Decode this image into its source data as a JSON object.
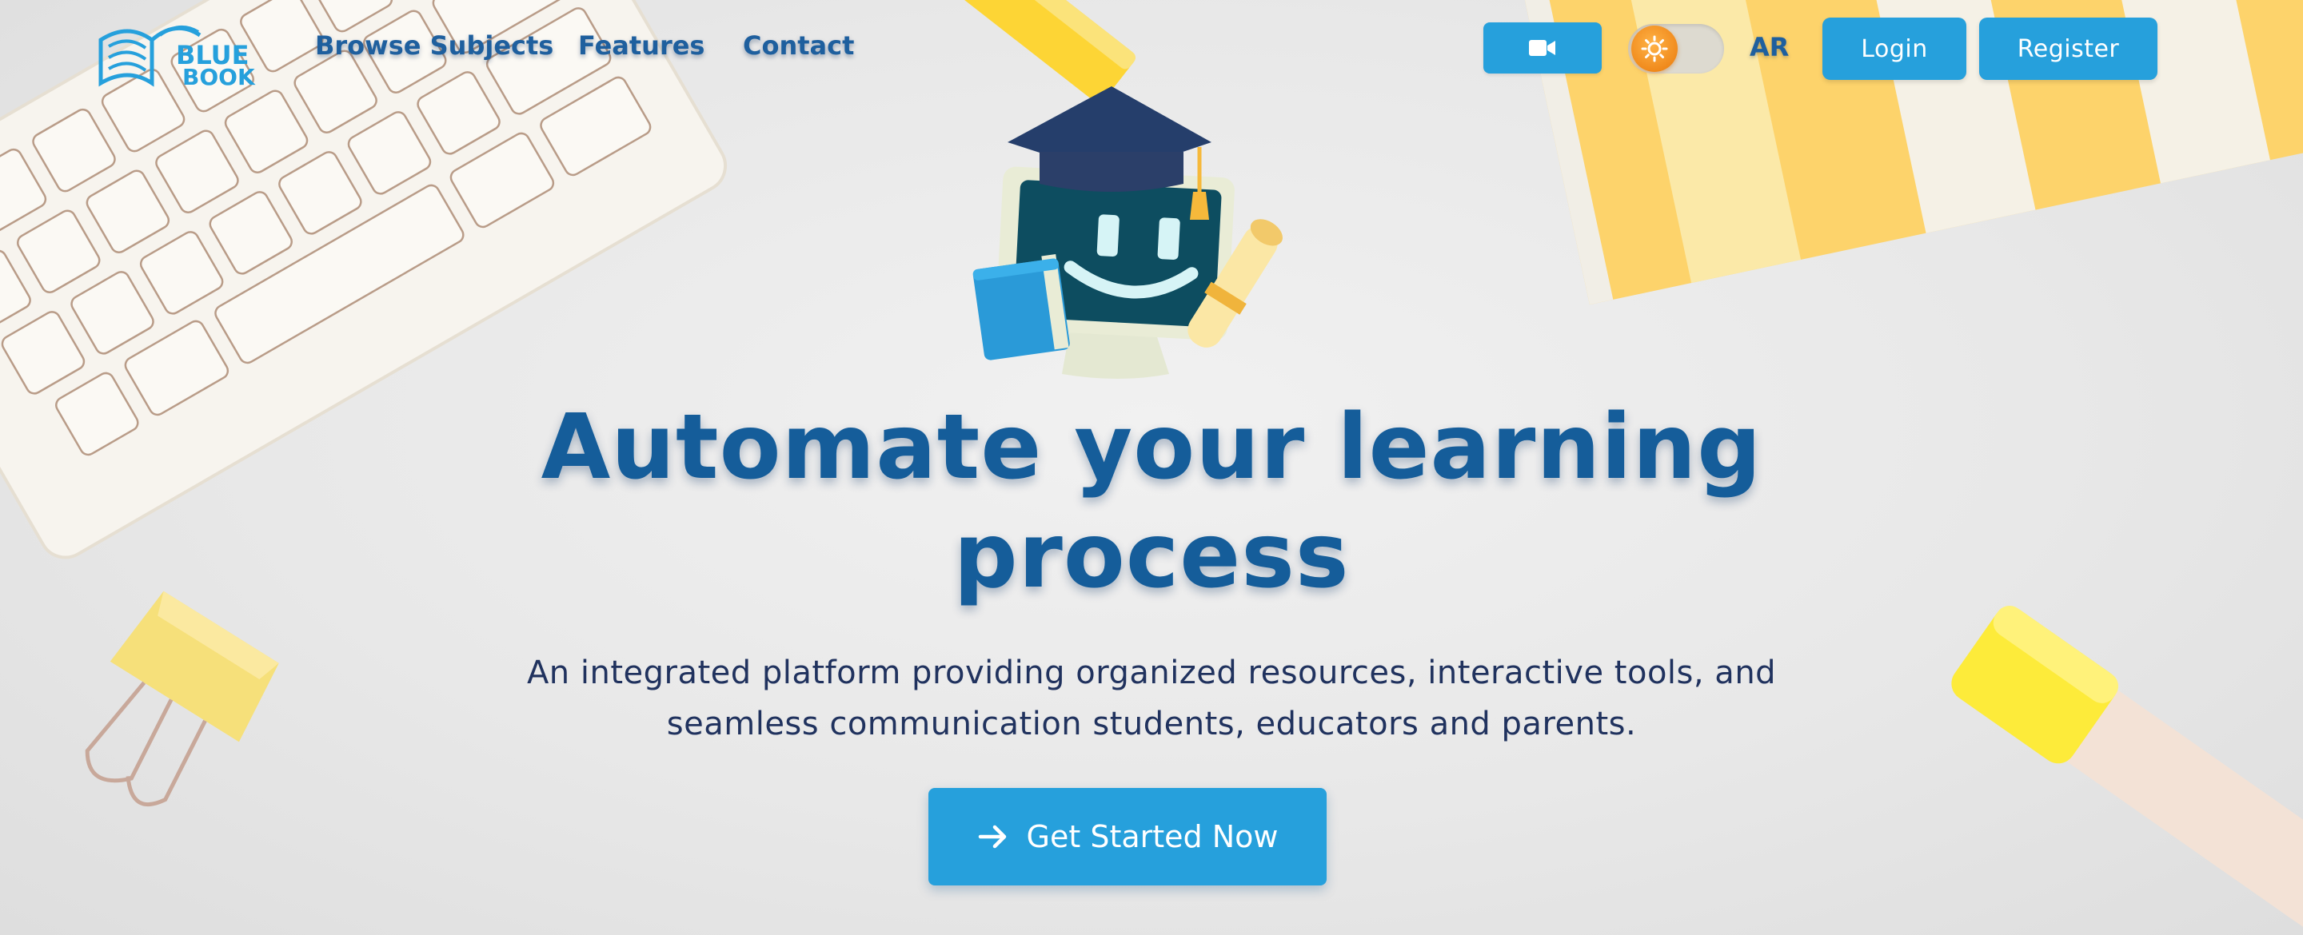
{
  "nav": {
    "logo": {
      "line1": "BLUE",
      "line2": "BOOK"
    },
    "links": [
      "Browse Subjects",
      "Features",
      "Contact"
    ],
    "language": "AR",
    "login_label": "Login",
    "register_label": "Register",
    "video_icon": "video-camera-icon",
    "theme_toggle_icon": "sun-icon"
  },
  "hero": {
    "headline_line1": "Automate your learning",
    "headline_line2": "process",
    "subtitle_line1": "An integrated platform providing organized resources, interactive tools, and",
    "subtitle_line2": "seamless communication students, educators and parents.",
    "cta_label": "Get Started Now",
    "cta_icon": "arrow-right-icon"
  },
  "colors": {
    "accent": "#26a0dc",
    "heading": "#155d9a",
    "text": "#20325e",
    "background": "#e9e9e9"
  }
}
